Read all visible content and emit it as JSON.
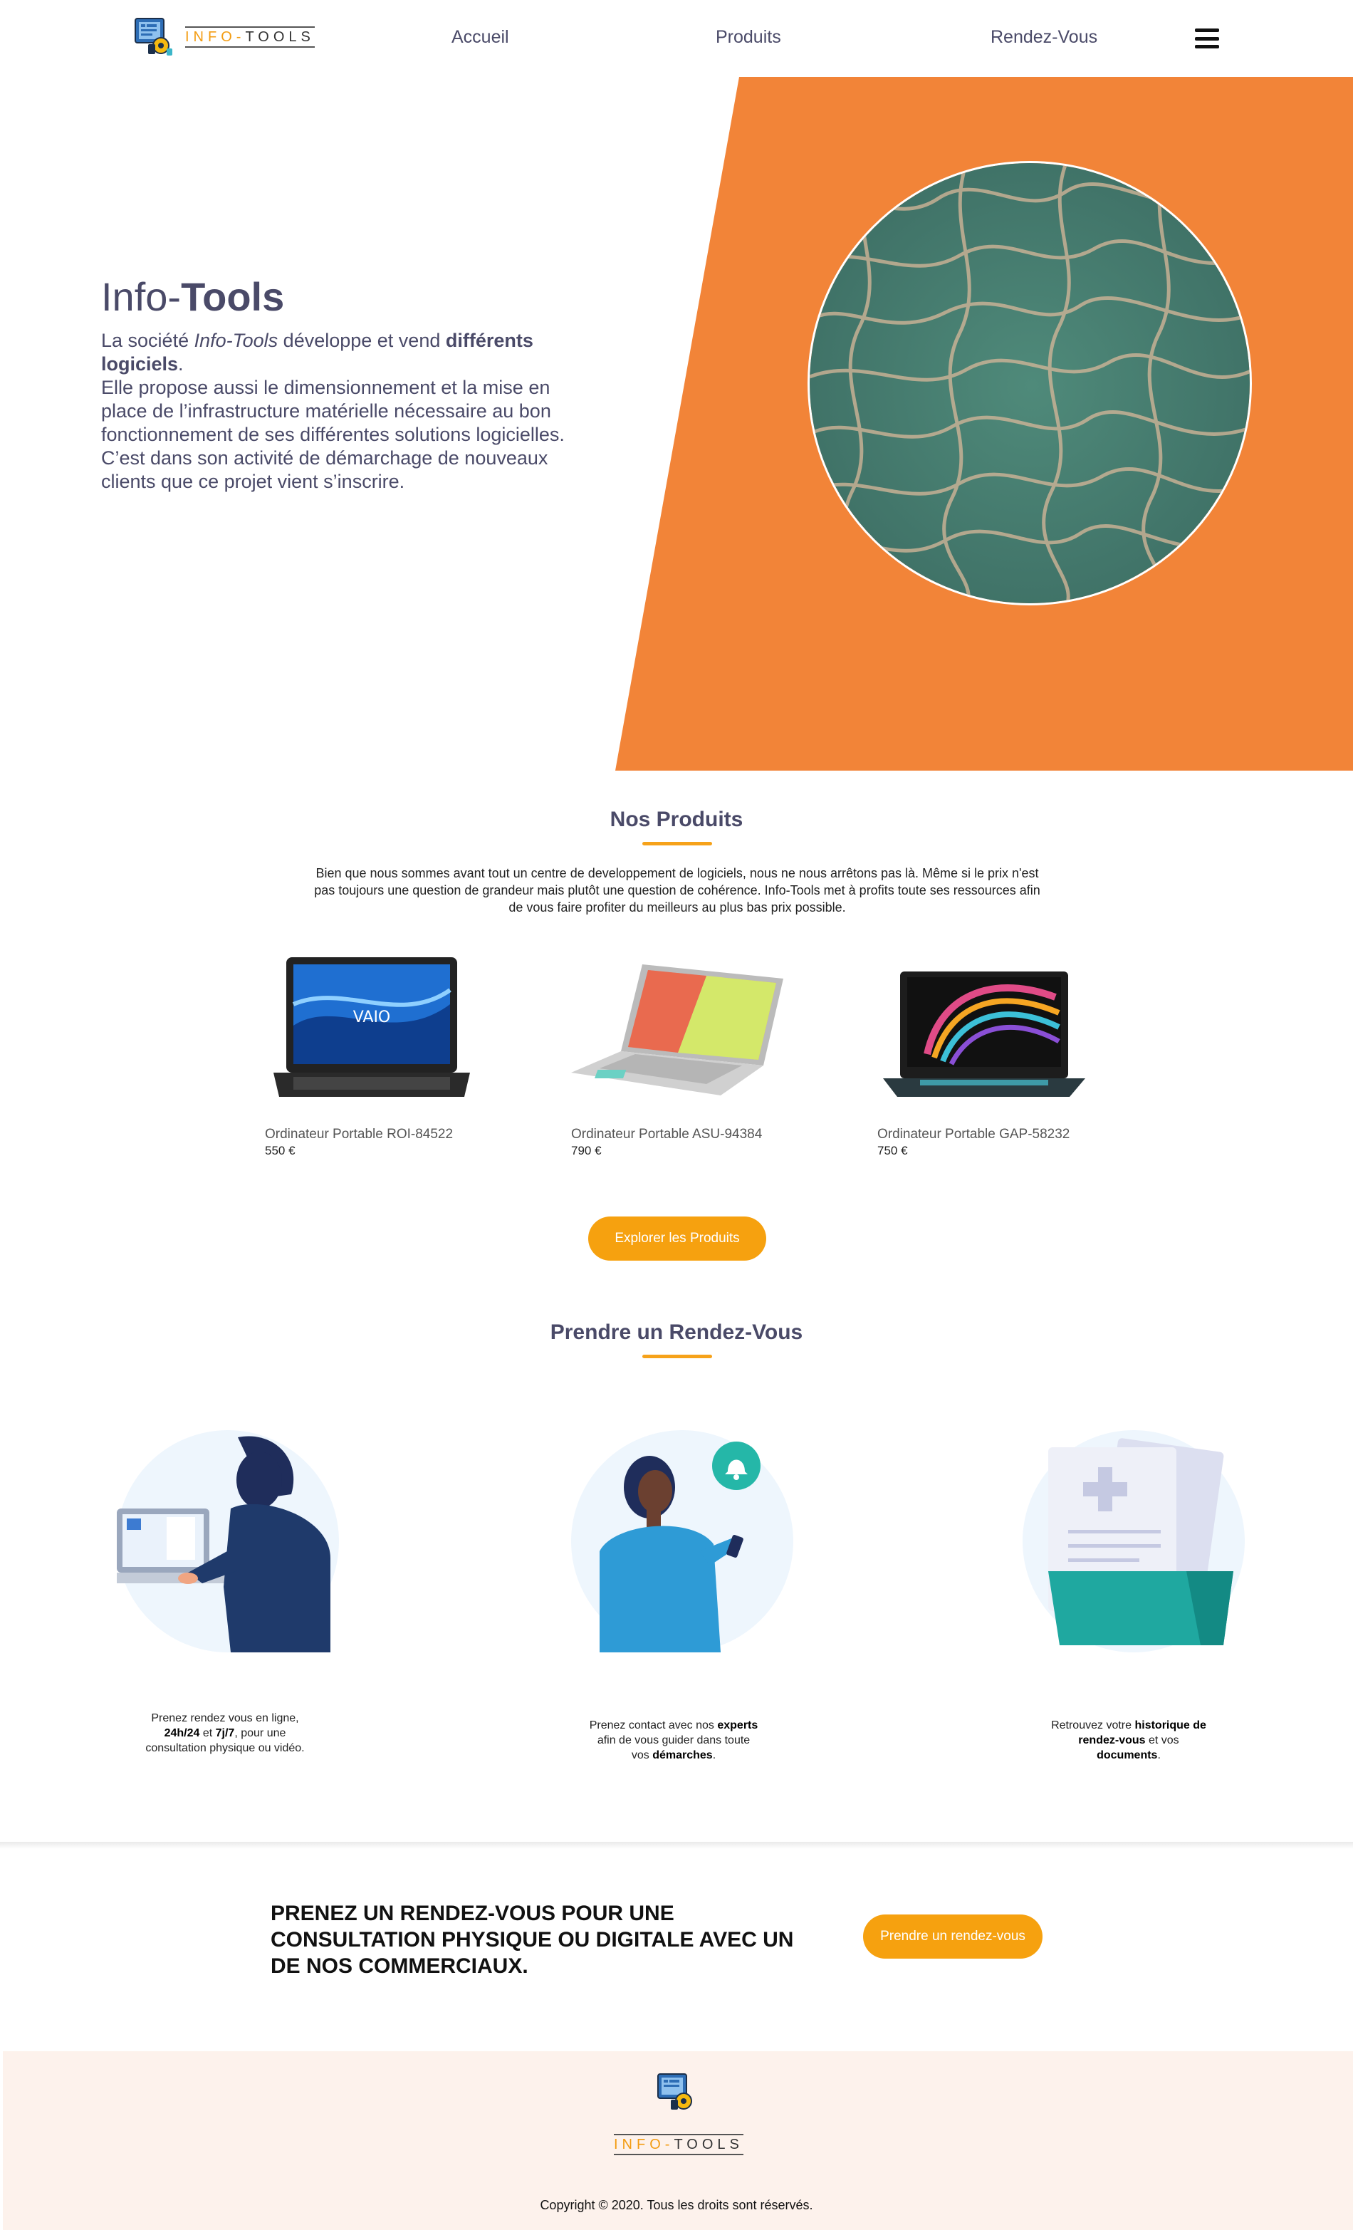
{
  "brand": {
    "name_part1": "INFO-",
    "name_part2": "TOOLS",
    "accent_color": "#f39c12"
  },
  "nav": {
    "items": [
      {
        "label": "Accueil"
      },
      {
        "label": "Produits"
      },
      {
        "label": "Rendez-Vous"
      }
    ],
    "menu_icon": "hamburger-icon"
  },
  "hero": {
    "title_part1": "Info-",
    "title_part2": "Tools",
    "line1_a": "La société ",
    "line1_b": "Info-Tools",
    "line1_c": " développe et vend ",
    "line1_d": "différents logiciels",
    "line1_e": ".",
    "para2": "Elle propose aussi le dimensionnement et la mise en place de l’infrastructure matérielle nécessaire au bon fonctionnement de ses différentes solutions logicielles.",
    "para3": "C’est dans son activité de démarchage de nouveaux clients que ce projet vient s’inscrire.",
    "bg_color": "#f28438"
  },
  "products": {
    "title": "Nos Produits",
    "intro": "Bien que nous sommes avant tout un centre de developpement de logiciels, nous ne nous arrêtons pas là. Même si le prix n'est pas toujours une question de grandeur mais plutôt une question de cohérence. Info-Tools met à profits toute ses ressources afin de vous faire profiter du meilleurs au plus bas prix possible.",
    "items": [
      {
        "name": "Ordinateur Portable ROI-84522",
        "price": "550 €"
      },
      {
        "name": "Ordinateur Portable ASU-94384",
        "price": "790 €"
      },
      {
        "name": "Ordinateur Portable GAP-58232",
        "price": "750 €"
      }
    ],
    "explore_label": "Explorer les Produits"
  },
  "appointments": {
    "title": "Prendre un Rendez-Vous",
    "cards": [
      {
        "t1": "Prenez rendez vous en ligne, ",
        "b1": "24h/24",
        "t2": " et ",
        "b2": "7j/7",
        "t3": ", pour une consultation physique ou vidéo."
      },
      {
        "t1": "Prenez contact avec nos ",
        "b1": "experts",
        "t2": " afin de vous guider dans toute vos ",
        "b2": "démarches",
        "t3": "."
      },
      {
        "t1": "Retrouvez votre ",
        "b1": "historique de rendez-vous",
        "t2": " et vos ",
        "b2": "documents",
        "t3": "."
      }
    ]
  },
  "cta": {
    "text": "PRENEZ UN RENDEZ-VOUS POUR UNE CONSULTATION PHYSIQUE OU DIGITALE AVEC UN DE NOS COMMERCIAUX.",
    "button_label": "Prendre un rendez-vous"
  },
  "footer": {
    "copyright": "Copyright © 2020. Tous les droits sont réservés."
  }
}
